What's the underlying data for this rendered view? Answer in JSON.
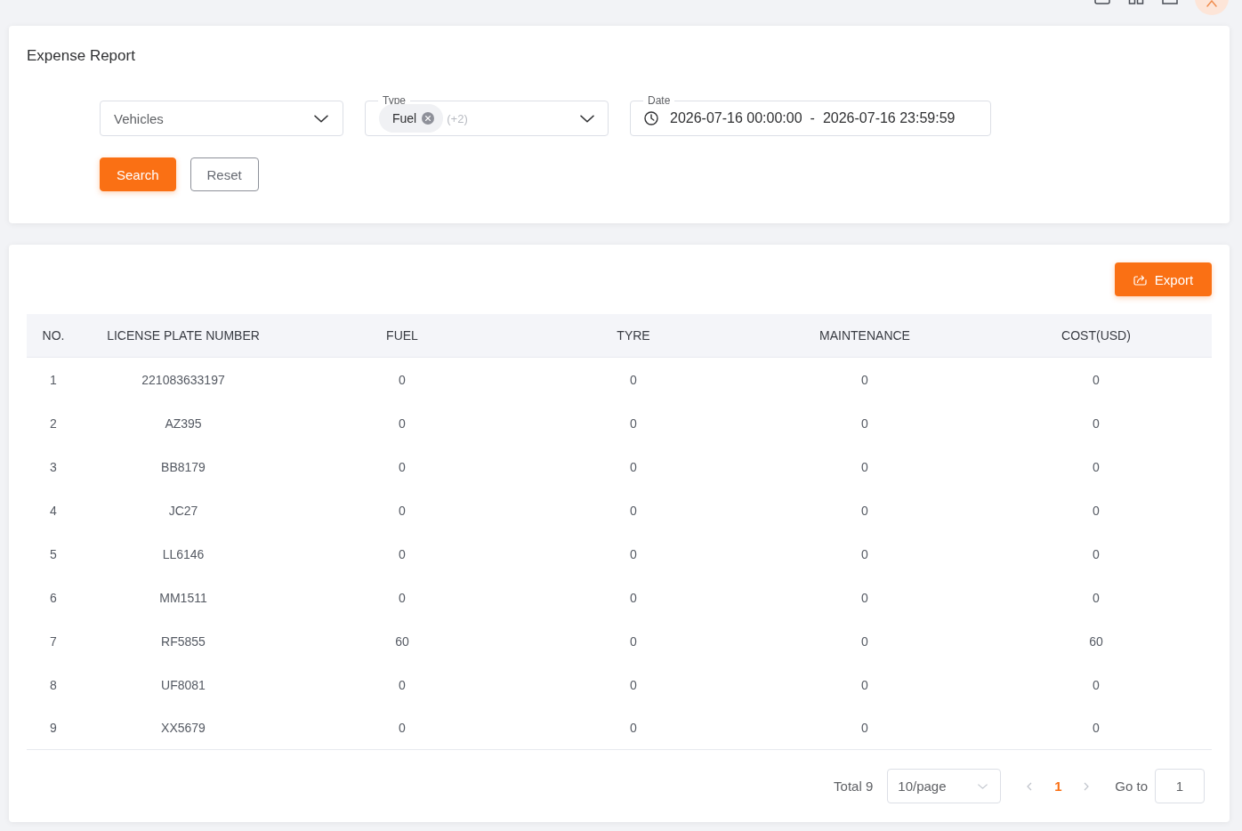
{
  "filter_panel": {
    "title": "Expense Report",
    "vehicles_select": {
      "placeholder": "Vehicles"
    },
    "type_select": {
      "label": "Type",
      "tags": [
        "Fuel"
      ],
      "more": "(+2)"
    },
    "date_range": {
      "label": "Date",
      "start": "2026-07-16 00:00:00",
      "separator": "-",
      "end": "2026-07-16 23:59:59"
    },
    "buttons": [
      {
        "label": "Search",
        "kind": "primary"
      },
      {
        "label": "Reset",
        "kind": "default"
      }
    ]
  },
  "table_panel": {
    "export_button": "Export",
    "table": {
      "columns": [
        "NO.",
        "LICENSE PLATE NUMBER",
        "FUEL",
        "TYRE",
        "MAINTENANCE",
        "COST(USD)"
      ],
      "rows": [
        [
          "1",
          "221083633197",
          "0",
          "0",
          "0",
          "0"
        ],
        [
          "2",
          "AZ395",
          "0",
          "0",
          "0",
          "0"
        ],
        [
          "3",
          "BB8179",
          "0",
          "0",
          "0",
          "0"
        ],
        [
          "4",
          "JC27",
          "0",
          "0",
          "0",
          "0"
        ],
        [
          "5",
          "LL6146",
          "0",
          "0",
          "0",
          "0"
        ],
        [
          "6",
          "MM1511",
          "0",
          "0",
          "0",
          "0"
        ],
        [
          "7",
          "RF5855",
          "60",
          "0",
          "0",
          "60"
        ],
        [
          "8",
          "UF8081",
          "0",
          "0",
          "0",
          "0"
        ],
        [
          "9",
          "XX5679",
          "0",
          "0",
          "0",
          "0"
        ]
      ]
    },
    "pagination": {
      "total": "Total 9",
      "page_size": "10/page",
      "prev": {
        "disabled": true
      },
      "pages": [
        {
          "label": "1",
          "selected": true
        }
      ],
      "next": {
        "disabled": true
      },
      "goto_label": "Go to",
      "goto_value": "1"
    }
  }
}
